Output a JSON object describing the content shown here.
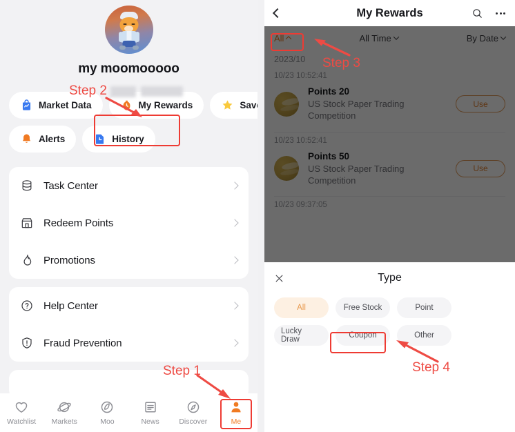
{
  "left": {
    "profile": {
      "username": "my moomooooo",
      "avatar_name": "chef-bull-avatar"
    },
    "quick_actions_row1": [
      {
        "label": "Market Data",
        "icon": "market-data-icon"
      },
      {
        "label": "My Rewards",
        "icon": "rewards-bag-icon"
      },
      {
        "label": "Saved",
        "icon": "star-icon"
      }
    ],
    "quick_actions_row2": [
      {
        "label": "Alerts",
        "icon": "bell-icon"
      },
      {
        "label": "History",
        "icon": "history-clock-icon"
      }
    ],
    "menu_card_1": [
      {
        "label": "Task Center",
        "icon": "database-icon"
      },
      {
        "label": "Redeem Points",
        "icon": "store-icon"
      },
      {
        "label": "Promotions",
        "icon": "flame-icon"
      }
    ],
    "menu_card_2": [
      {
        "label": "Help Center",
        "icon": "question-circle-icon"
      },
      {
        "label": "Fraud Prevention",
        "icon": "warning-shield-icon"
      }
    ],
    "tabbar": [
      {
        "label": "Watchlist",
        "icon": "heart-icon",
        "active": false
      },
      {
        "label": "Markets",
        "icon": "planet-icon",
        "active": false
      },
      {
        "label": "Moo",
        "icon": "moo-icon",
        "active": false
      },
      {
        "label": "News",
        "icon": "news-icon",
        "active": false
      },
      {
        "label": "Discover",
        "icon": "compass-icon",
        "active": false
      },
      {
        "label": "Me",
        "icon": "person-icon",
        "active": true
      }
    ]
  },
  "right": {
    "header": {
      "title": "My Rewards",
      "back_icon": "back-chevron-icon",
      "search_icon": "search-icon",
      "more_icon": "more-dots-icon"
    },
    "filters": {
      "type": "All",
      "time": "All Time",
      "sort": "By Date"
    },
    "month_label": "2023/10",
    "rewards": [
      {
        "timestamp": "10/23 10:52:41",
        "title": "Points 20",
        "subtitle": "US Stock Paper Trading Competition",
        "action": "Use",
        "icon": "coin-icon"
      },
      {
        "timestamp": "10/23 10:52:41",
        "title": "Points 50",
        "subtitle": "US Stock Paper Trading Competition",
        "action": "Use",
        "icon": "coin-icon"
      }
    ],
    "trailing_timestamp": "10/23 09:37:05",
    "sheet": {
      "title": "Type",
      "close_icon": "close-x-icon",
      "options": [
        {
          "label": "All",
          "selected": true
        },
        {
          "label": "Free Stock",
          "selected": false
        },
        {
          "label": "Point",
          "selected": false
        },
        {
          "label": "Lucky Draw",
          "selected": false
        },
        {
          "label": "Coupon",
          "selected": false
        },
        {
          "label": "Other",
          "selected": false
        }
      ]
    }
  },
  "annotations": {
    "step1": "Step 1",
    "step2": "Step 2",
    "step3": "Step 3",
    "step4": "Step 4",
    "accent_color": "#ee4b44"
  }
}
